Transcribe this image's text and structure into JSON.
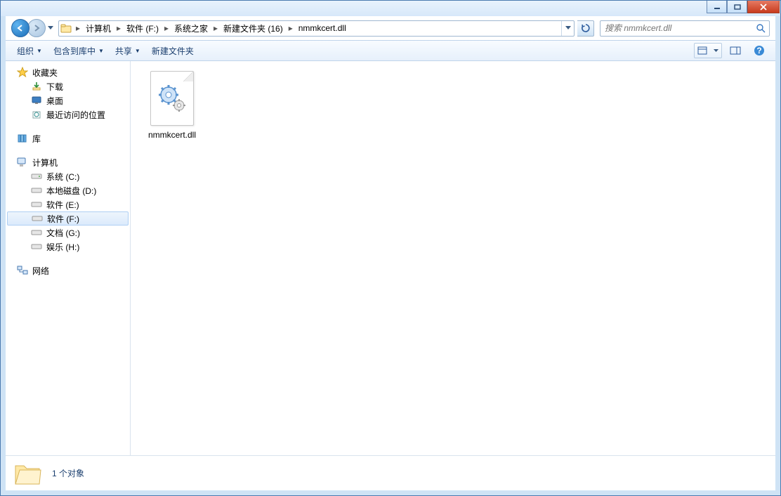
{
  "breadcrumbs": [
    "计算机",
    "软件 (F:)",
    "系统之家",
    "新建文件夹 (16)",
    "nmmkcert.dll"
  ],
  "search": {
    "placeholder": "搜索 nmmkcert.dll"
  },
  "toolbar": {
    "organize": "组织",
    "include": "包含到库中",
    "share": "共享",
    "newfolder": "新建文件夹"
  },
  "sidebar": {
    "favorites": {
      "label": "收藏夹",
      "items": [
        "下载",
        "桌面",
        "最近访问的位置"
      ]
    },
    "libraries": {
      "label": "库"
    },
    "computer": {
      "label": "计算机",
      "items": [
        "系统 (C:)",
        "本地磁盘 (D:)",
        "软件 (E:)",
        "软件 (F:)",
        "文档 (G:)",
        "娱乐 (H:)"
      ],
      "selected": "软件 (F:)"
    },
    "network": {
      "label": "网络"
    }
  },
  "files": [
    {
      "name": "nmmkcert.dll"
    }
  ],
  "status": {
    "text": "1 个对象"
  }
}
